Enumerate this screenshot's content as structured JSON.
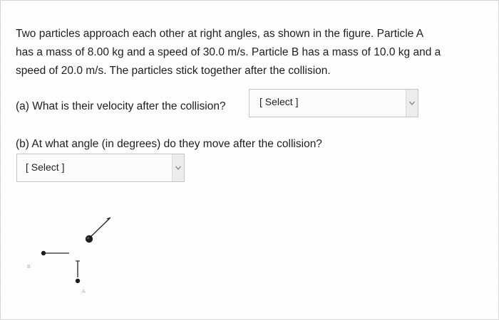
{
  "question": {
    "line1": "Two particles approach each other at right angles, as shown in the figure. Particle A",
    "line2": "has a mass of 8.00 kg and a speed of 30.0 m/s. Particle B has a mass of 10.0 kg and a",
    "line3": "speed of 20.0 m/s.  The particles stick together after the collision."
  },
  "part_a": {
    "prompt": "(a) What is their velocity after the collision?",
    "select_value": "[ Select ]"
  },
  "part_b": {
    "prompt": "(b) At what angle (in  degrees) do they move after the collision?",
    "select_value": "[ Select ]"
  },
  "figure": {
    "label_b": "B",
    "label_a": "A"
  },
  "icons": {
    "dropdown": "chevron-down-icon"
  }
}
